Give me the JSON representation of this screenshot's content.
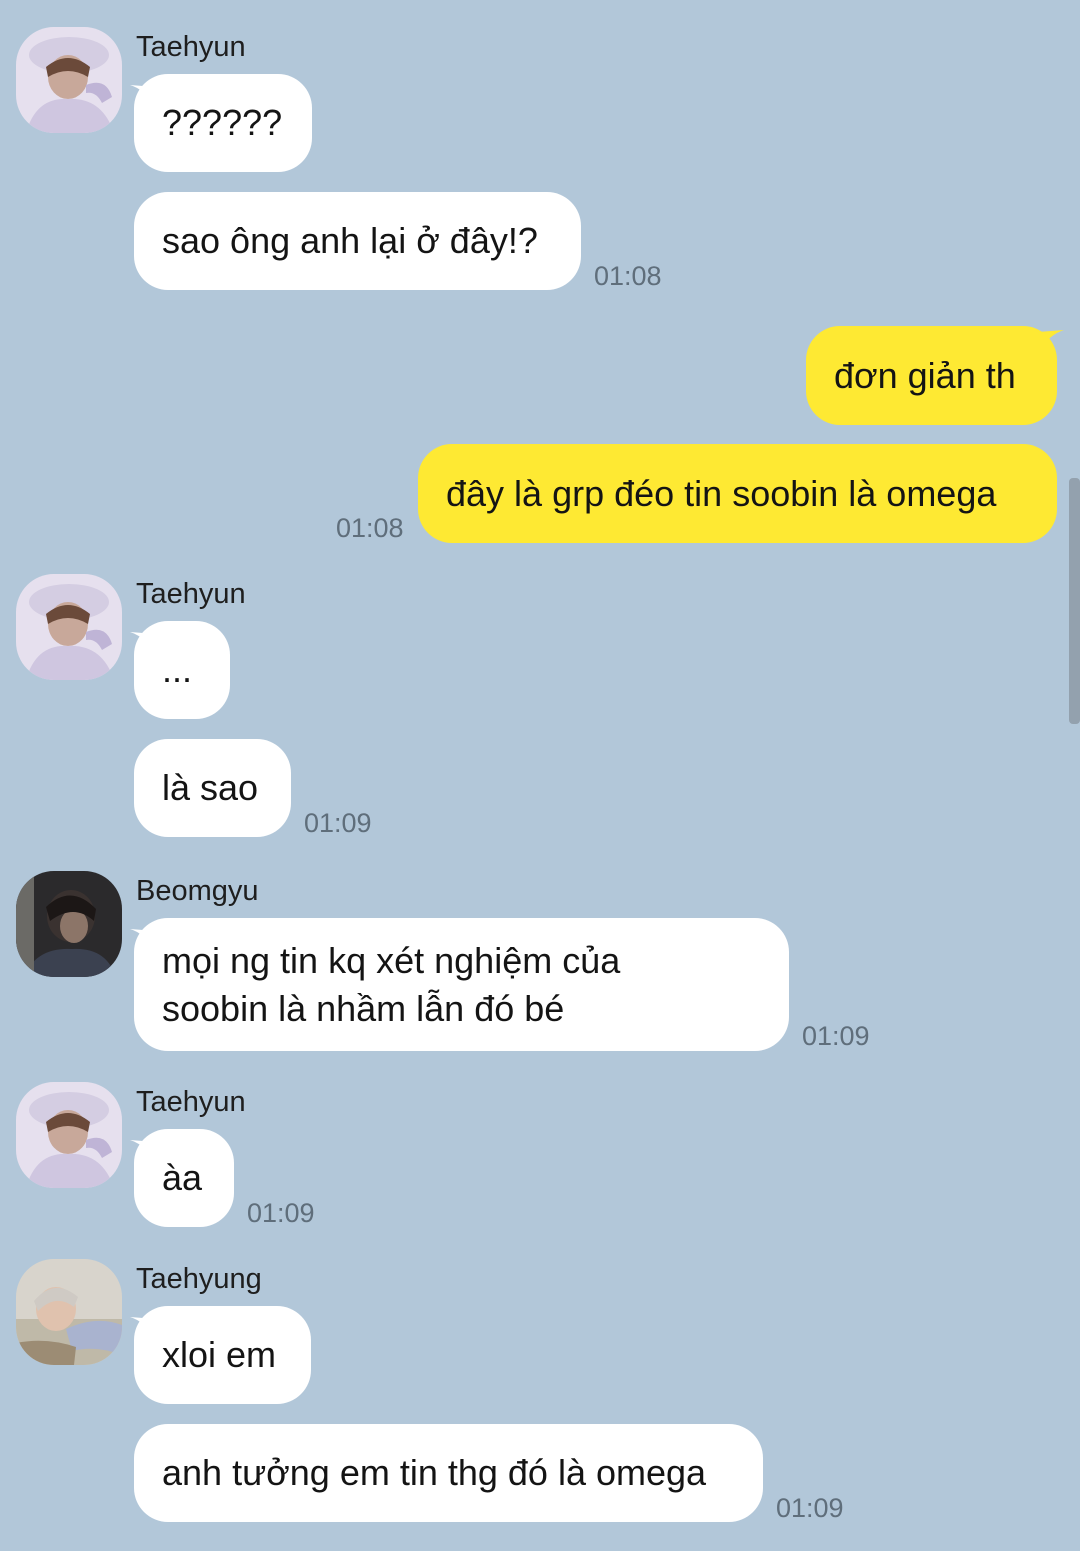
{
  "colors": {
    "background": "#b2c7d9",
    "incoming_bubble": "#ffffff",
    "outgoing_bubble": "#fee933",
    "timestamp": "#5f6e7b"
  },
  "messages": [
    {
      "sender": "Taehyun",
      "avatar": "taehyun-avatar-icon",
      "lines": [
        "??????",
        "sao ông anh lại ở đây!?"
      ],
      "time": "01:08"
    },
    {
      "sender": "me",
      "lines": [
        "đơn giản th",
        "đây là grp đéo tin soobin là omega"
      ],
      "time": "01:08"
    },
    {
      "sender": "Taehyun",
      "avatar": "taehyun-avatar-icon",
      "lines": [
        "...",
        "là sao"
      ],
      "time": "01:09"
    },
    {
      "sender": "Beomgyu",
      "avatar": "beomgyu-avatar-icon",
      "lines": [
        "mọi ng tin kq xét nghiệm của soobin là nhầm lẫn đó bé"
      ],
      "time": "01:09"
    },
    {
      "sender": "Taehyun",
      "avatar": "taehyun-avatar-icon",
      "lines": [
        "àa"
      ],
      "time": "01:09"
    },
    {
      "sender": "Taehyung",
      "avatar": "taehyung-avatar-icon",
      "lines": [
        "xloi em",
        "anh tưởng em tin thg đó là omega"
      ],
      "time": "01:09"
    }
  ]
}
